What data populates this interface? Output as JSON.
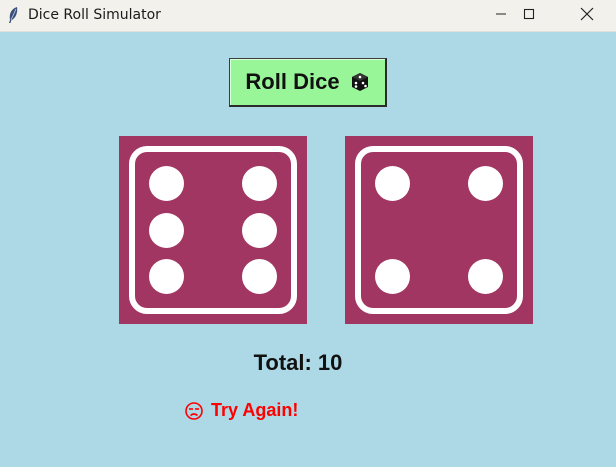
{
  "window": {
    "title": "Dice Roll Simulator",
    "controls": {
      "minimize_icon": "minimize-icon",
      "maximize_icon": "maximize-icon",
      "close_icon": "close-icon"
    }
  },
  "roll_button": {
    "label": "Roll Dice",
    "icon": "dice-icon"
  },
  "dice": [
    {
      "value": 6
    },
    {
      "value": 4
    }
  ],
  "total": {
    "text": "Total: 10"
  },
  "result": {
    "text": "Try Again!",
    "icon": "sad-face-icon",
    "color": "#ff0000"
  },
  "colors": {
    "background": "#add8e6",
    "die": "#a23662",
    "pip": "#ffffff",
    "button": "#98f598"
  }
}
